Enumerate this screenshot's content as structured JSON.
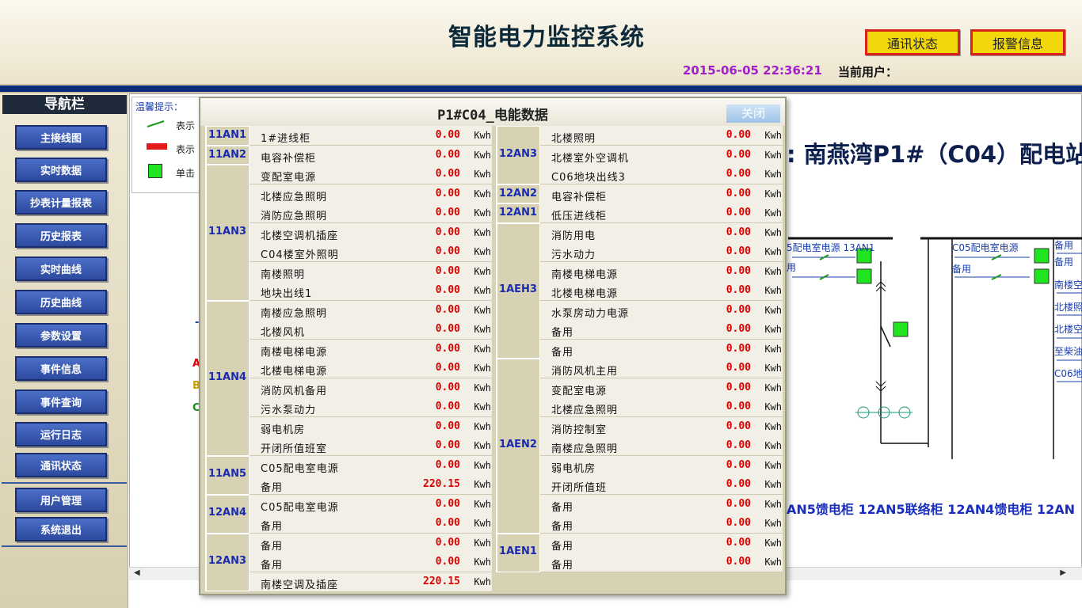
{
  "header": {
    "title": "智能电力监控系统",
    "comm_button": "通讯状态",
    "alarm_button": "报警信息",
    "datetime": "2015-06-05 22:36:21",
    "user_label": "当前用户："
  },
  "nav": {
    "title": "导航栏",
    "items": [
      "主接线图",
      "实时数据",
      "抄表计量报表",
      "历史报表",
      "实时曲线",
      "历史曲线",
      "参数设置",
      "事件信息",
      "事件查询",
      "运行日志",
      "通讯状态",
      "用户管理",
      "系统退出"
    ]
  },
  "tips": {
    "title": "温馨提示：",
    "lines": [
      "表示",
      "表示",
      "单击"
    ]
  },
  "station": {
    "title": ": 南燕湾P1#（C04）配电站",
    "diagram_labels": [
      "5配电室电源 13AN1",
      "用",
      "C05配电室电源",
      "备用",
      "备用",
      "备用",
      "南楼空",
      "北楼照",
      "北楼空",
      "至柴油",
      "C06地"
    ],
    "cabinets": "AN5馈电柜   12AN5联络柜   12AN4馈电柜   12AN",
    "fragments": [
      "A",
      "B",
      "C",
      "-"
    ]
  },
  "popup": {
    "title": "P1#C04_电能数据",
    "close": "关闭",
    "left_groups": [
      {
        "label": "11AN1",
        "rows": [
          {
            "name": "1#进线柜",
            "value": "0.00",
            "unit": "Kwh"
          }
        ]
      },
      {
        "label": "11AN2",
        "rows": [
          {
            "name": "电容补偿柜",
            "value": "0.00",
            "unit": "Kwh"
          }
        ]
      },
      {
        "label": "11AN3",
        "rows": [
          {
            "name": "变配室电源",
            "value": "0.00",
            "unit": "Kwh"
          },
          {
            "name": "北楼应急照明",
            "value": "0.00",
            "unit": "Kwh"
          },
          {
            "name": "消防应急照明",
            "value": "0.00",
            "unit": "Kwh"
          },
          {
            "name": "北楼空调机插座",
            "value": "0.00",
            "unit": "Kwh"
          },
          {
            "name": "C04楼室外照明",
            "value": "0.00",
            "unit": "Kwh"
          },
          {
            "name": "南楼照明",
            "value": "0.00",
            "unit": "Kwh"
          },
          {
            "name": "地块出线1",
            "value": "0.00",
            "unit": "Kwh"
          }
        ]
      },
      {
        "label": "11AN4",
        "rows": [
          {
            "name": "南楼应急照明",
            "value": "0.00",
            "unit": "Kwh"
          },
          {
            "name": "北楼风机",
            "value": "0.00",
            "unit": "Kwh"
          },
          {
            "name": "南楼电梯电源",
            "value": "0.00",
            "unit": "Kwh"
          },
          {
            "name": "北楼电梯电源",
            "value": "0.00",
            "unit": "Kwh"
          },
          {
            "name": "消防风机备用",
            "value": "0.00",
            "unit": "Kwh"
          },
          {
            "name": "污水泵动力",
            "value": "0.00",
            "unit": "Kwh"
          },
          {
            "name": "弱电机房",
            "value": "0.00",
            "unit": "Kwh"
          },
          {
            "name": "开闭所值班室",
            "value": "0.00",
            "unit": "Kwh"
          }
        ]
      },
      {
        "label": "11AN5",
        "rows": [
          {
            "name": "C05配电室电源",
            "value": "0.00",
            "unit": "Kwh"
          },
          {
            "name": "备用",
            "value": "220.15",
            "unit": "Kwh"
          }
        ]
      },
      {
        "label": "12AN4",
        "rows": [
          {
            "name": "C05配电室电源",
            "value": "0.00",
            "unit": "Kwh"
          },
          {
            "name": "备用",
            "value": "0.00",
            "unit": "Kwh"
          }
        ]
      },
      {
        "label": "12AN3",
        "rows": [
          {
            "name": "备用",
            "value": "0.00",
            "unit": "Kwh"
          },
          {
            "name": "备用",
            "value": "0.00",
            "unit": "Kwh"
          },
          {
            "name": "南楼空调及插座",
            "value": "220.15",
            "unit": "Kwh"
          }
        ]
      }
    ],
    "right_groups": [
      {
        "label": "12AN3",
        "rows": [
          {
            "name": "北楼照明",
            "value": "0.00",
            "unit": "Kwh"
          },
          {
            "name": "北楼室外空调机",
            "value": "0.00",
            "unit": "Kwh"
          },
          {
            "name": "C06地块出线3",
            "value": "0.00",
            "unit": "Kwh"
          }
        ]
      },
      {
        "label": "12AN2",
        "rows": [
          {
            "name": "电容补偿柜",
            "value": "0.00",
            "unit": "Kwh"
          }
        ]
      },
      {
        "label": "12AN1",
        "rows": [
          {
            "name": "低压进线柜",
            "value": "0.00",
            "unit": "Kwh"
          }
        ]
      },
      {
        "label": "1AEH3",
        "rows": [
          {
            "name": "消防用电",
            "value": "0.00",
            "unit": "Kwh"
          },
          {
            "name": "污水动力",
            "value": "0.00",
            "unit": "Kwh"
          },
          {
            "name": "南楼电梯电源",
            "value": "0.00",
            "unit": "Kwh"
          },
          {
            "name": "北楼电梯电源",
            "value": "0.00",
            "unit": "Kwh"
          },
          {
            "name": "水泵房动力电源",
            "value": "0.00",
            "unit": "Kwh"
          },
          {
            "name": "备用",
            "value": "0.00",
            "unit": "Kwh"
          },
          {
            "name": "备用",
            "value": "0.00",
            "unit": "Kwh"
          }
        ]
      },
      {
        "label": "1AEN2",
        "rows": [
          {
            "name": "消防风机主用",
            "value": "0.00",
            "unit": "Kwh"
          },
          {
            "name": "变配室电源",
            "value": "0.00",
            "unit": "Kwh"
          },
          {
            "name": "北楼应急照明",
            "value": "0.00",
            "unit": "Kwh"
          },
          {
            "name": "消防控制室",
            "value": "0.00",
            "unit": "Kwh"
          },
          {
            "name": "南楼应急照明",
            "value": "0.00",
            "unit": "Kwh"
          },
          {
            "name": "弱电机房",
            "value": "0.00",
            "unit": "Kwh"
          },
          {
            "name": "开闭所值班",
            "value": "0.00",
            "unit": "Kwh"
          },
          {
            "name": "备用",
            "value": "0.00",
            "unit": "Kwh"
          },
          {
            "name": "备用",
            "value": "0.00",
            "unit": "Kwh"
          }
        ]
      },
      {
        "label": "1AEN1",
        "rows": [
          {
            "name": "备用",
            "value": "0.00",
            "unit": "Kwh"
          },
          {
            "name": "备用",
            "value": "0.00",
            "unit": "Kwh"
          }
        ]
      }
    ]
  },
  "colors": {
    "nav_button": "#2c4a9e",
    "header_bar": "#0b2a7a",
    "alarm_value": "#dd0000",
    "group_label": "#1b2bb0",
    "top_button": "#f2d80a",
    "status_on": "#1ee51e"
  }
}
